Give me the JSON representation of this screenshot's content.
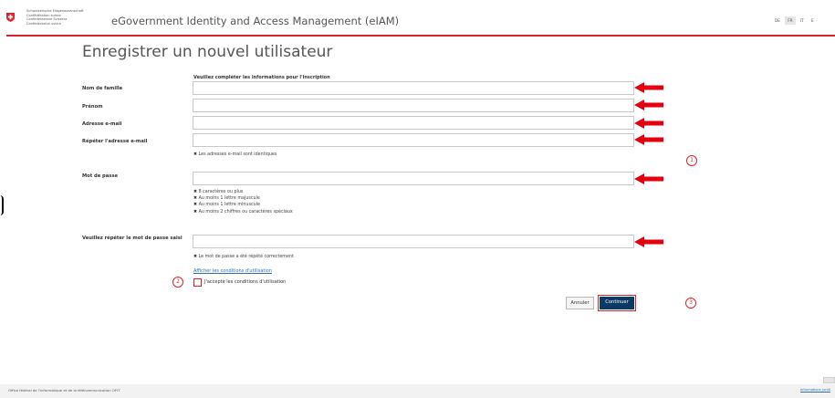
{
  "header": {
    "confederation_lines": [
      "Schweizerische Eidgenossenschaft",
      "Confédération suisse",
      "Confederazione Svizzera",
      "Confederaziun svizra"
    ],
    "app_title": "eGovernment Identity and Access Management (eIAM)",
    "languages": [
      "DE",
      "FR",
      "IT",
      "E"
    ],
    "active_language": "FR",
    "accent_color": "#d8232a"
  },
  "page": {
    "title": "Enregistrer un nouvel utilisateur",
    "subtitle": "Veuillez compléter les informations pour l'inscription"
  },
  "form": {
    "last_name_label": "Nom de famille",
    "last_name_value": "",
    "first_name_label": "Prénom",
    "first_name_value": "",
    "email_label": "Adresse e-mail",
    "email_value": "",
    "email_repeat_label": "Répéter l'adresse e-mail",
    "email_repeat_value": "",
    "email_hint": "Les adresses e-mail sont identiques",
    "password_label": "Mot de passe",
    "password_value": "",
    "password_hints": [
      "8 caractères ou plus",
      "Au moins 1 lettre majuscule",
      "Au moins 1 lettre minuscule",
      "Au moins 2 chiffres ou caractères spéciaux"
    ],
    "password_repeat_label": "Veuillez répéter le mot de passe saisi",
    "password_repeat_value": "",
    "password_repeat_hint": "Le mot de passe a été répété correctement",
    "terms_link": "Afficher les conditions d'utilisation",
    "terms_checkbox_label": "J'accepte les conditions d'utilisation",
    "terms_checked": false
  },
  "buttons": {
    "cancel": "Annuler",
    "continue": "Continuer"
  },
  "markers": [
    "1",
    "2",
    "3"
  ],
  "footer": {
    "left_text": "Office fédéral de l'informatique et de la télécommunication OFIT",
    "right_link": "Informations juridi"
  },
  "icons": {
    "logo": "swiss-cross-icon",
    "arrow": "red-arrow-left-icon",
    "cross": "x-mark-icon"
  }
}
